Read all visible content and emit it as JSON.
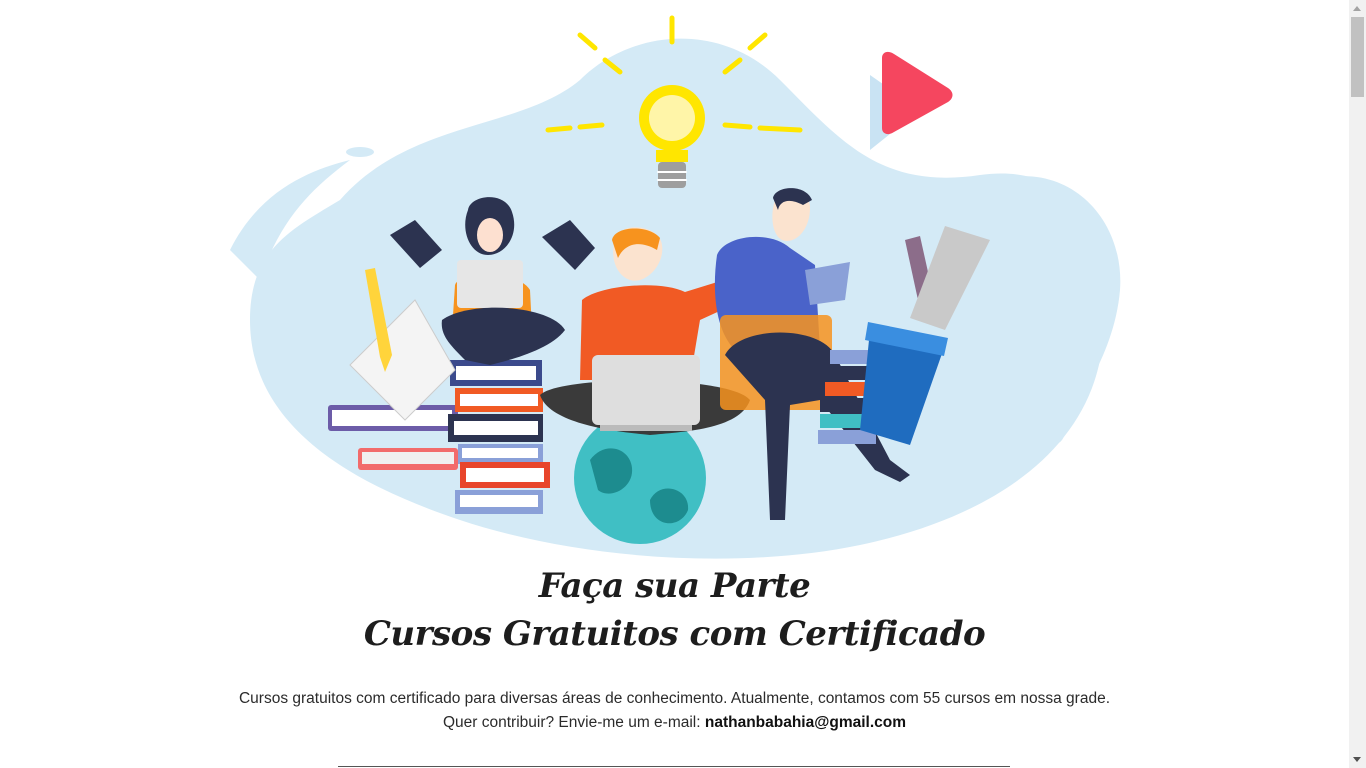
{
  "hero": {
    "illustration_name": "students-studying-illustration",
    "colors": {
      "blob": "#d4eaf6",
      "bulb": "#ffe600",
      "play": "#f5465f",
      "orange": "#f15a24",
      "navy": "#2c3350",
      "globe": "#40bfc4"
    }
  },
  "heading": {
    "line1": "Faça sua Parte",
    "line2": "Cursos Gratuitos com Certificado"
  },
  "description": {
    "line1": "Cursos gratuitos com certificado para diversas áreas de conhecimento. Atualmente, contamos com 55 cursos em nossa grade.",
    "line2_prefix": "Quer contribuir? Envie-me um e-mail: ",
    "email": "nathanbabahia@gmail.com"
  }
}
